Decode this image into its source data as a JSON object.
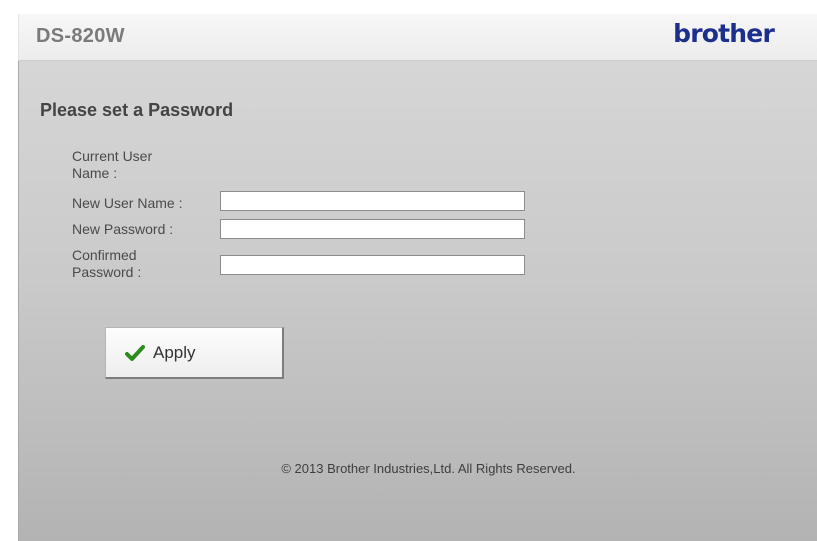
{
  "header": {
    "model_name": "DS-820W",
    "brand": "brother"
  },
  "form": {
    "title": "Please set a Password",
    "fields": [
      {
        "label": "Current User Name :",
        "value": ""
      },
      {
        "label": "New User Name :",
        "value": ""
      },
      {
        "label": "New Password :",
        "value": ""
      },
      {
        "label": "Confirmed Password :",
        "value": ""
      }
    ],
    "apply_label": "Apply"
  },
  "footer": {
    "copyright": "© 2013 Brother Industries,Ltd. All Rights Reserved."
  },
  "colors": {
    "brand": "#1c2f8c",
    "check": "#2e8b1e"
  },
  "icons": {
    "apply": "checkmark-icon"
  }
}
